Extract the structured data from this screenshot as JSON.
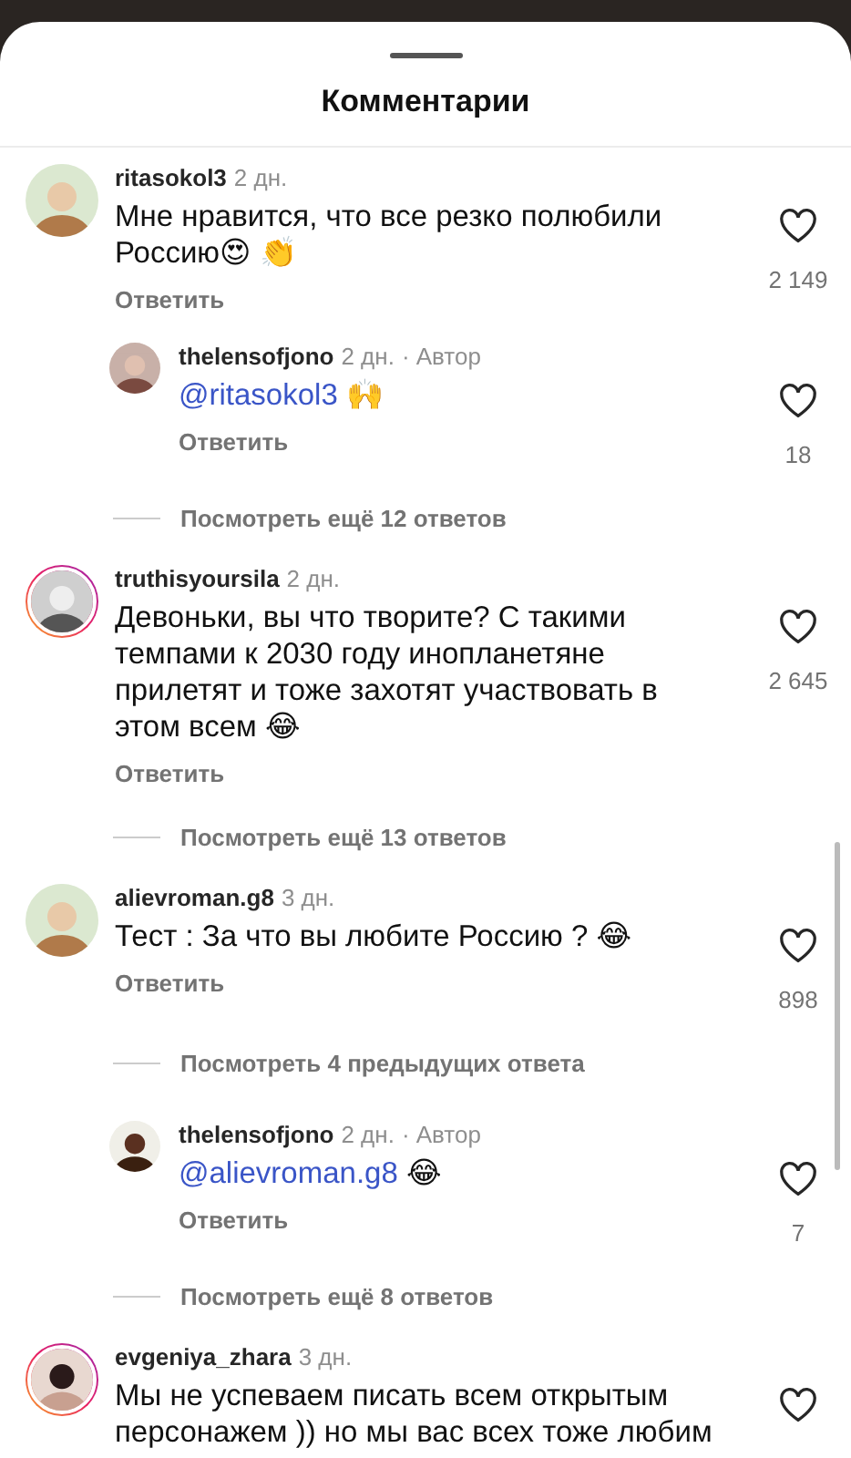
{
  "sheet": {
    "title": "Комментарии"
  },
  "items": [
    {
      "kind": "comment",
      "username": "ritasokol3",
      "time": "2 дн.",
      "story_ring": false,
      "text": "Мне нравится, что все резко полюбили Россию😍 👏",
      "reply": "Ответить",
      "likes": "2 149",
      "liked": false
    },
    {
      "kind": "reply",
      "username": "thelensofjono",
      "time": "2 дн.",
      "story_ring": false,
      "author_label": "· Автор",
      "mention": "@ritasokol3",
      "text": "🙌",
      "reply": "Ответить",
      "likes": "18",
      "liked": false
    },
    {
      "kind": "view_more",
      "text": "Посмотреть ещё 12 ответов"
    },
    {
      "kind": "comment",
      "username": "truthisyoursila",
      "time": "2 дн.",
      "story_ring": true,
      "text": "Девоньки, вы что творите? С такими темпами к 2030 году инопланетяне прилетят и тоже захотят участвовать в этом всем 😂",
      "reply": "Ответить",
      "likes": "2 645",
      "liked": false
    },
    {
      "kind": "view_more",
      "text": "Посмотреть ещё 13 ответов"
    },
    {
      "kind": "comment",
      "username": "alievroman.g8",
      "time": "3 дн.",
      "story_ring": false,
      "text": "Тест : За что вы любите Россию ? 😂",
      "reply": "Ответить",
      "likes": "898",
      "liked": false
    },
    {
      "kind": "view_more",
      "text": "Посмотреть 4 предыдущих ответа"
    },
    {
      "kind": "reply",
      "username": "thelensofjono",
      "time": "2 дн.",
      "story_ring": false,
      "author_label": "· Автор",
      "mention": "@alievroman.g8",
      "text": "😂",
      "reply": "Ответить",
      "likes": "7",
      "liked": false
    },
    {
      "kind": "view_more",
      "text": "Посмотреть ещё 8 ответов"
    },
    {
      "kind": "comment",
      "username": "evgeniya_zhara",
      "time": "3 дн.",
      "story_ring": true,
      "text": "Мы не успеваем писать всем открытым персонажем )) но мы вас всех тоже любим",
      "liked": false
    }
  ]
}
